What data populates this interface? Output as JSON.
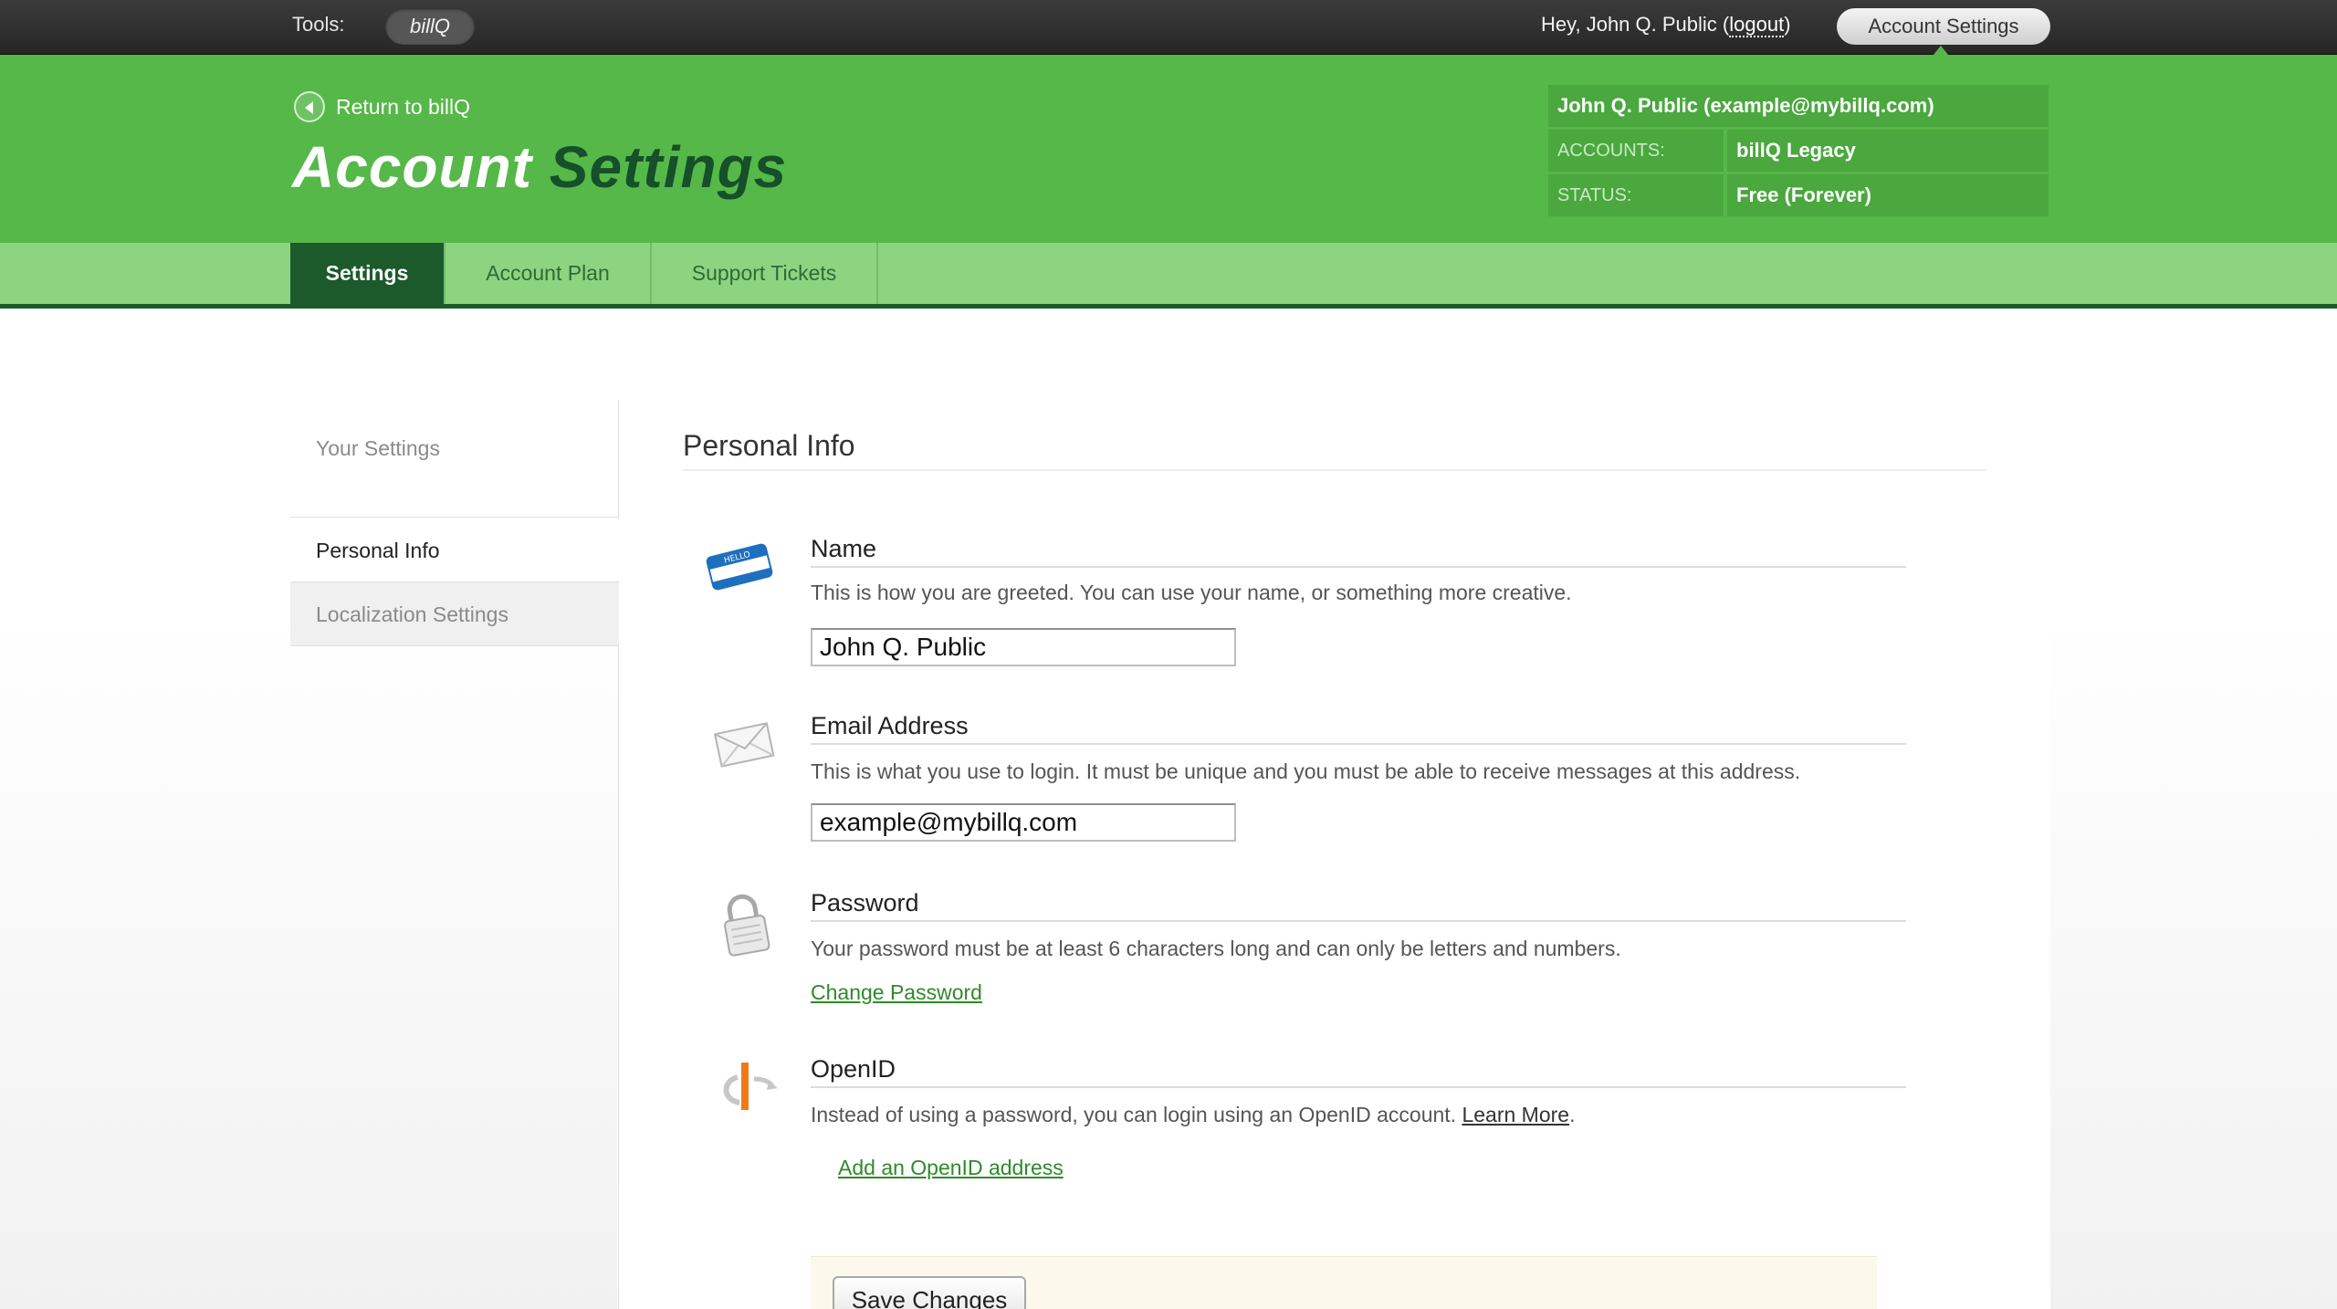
{
  "topbar": {
    "tools_label": "Tools:",
    "tool_name": "billQ",
    "greeting_prefix": "Hey, John Q. Public (",
    "logout_label": "logout",
    "greeting_suffix": ")",
    "account_settings_label": "Account Settings"
  },
  "header": {
    "return_label": "Return to billQ",
    "title_word1": "Account",
    "title_word2": "Settings",
    "user_line": "John Q. Public (example@mybillq.com)",
    "accounts_label": "ACCOUNTS:",
    "accounts_value": "billQ Legacy",
    "status_label": "STATUS:",
    "status_value": "Free (Forever)"
  },
  "tabs": [
    {
      "label": "Settings",
      "active": true
    },
    {
      "label": "Account Plan",
      "active": false
    },
    {
      "label": "Support Tickets",
      "active": false
    }
  ],
  "sidebar": {
    "heading": "Your Settings",
    "items": [
      {
        "label": "Personal Info",
        "selected": true
      },
      {
        "label": "Localization Settings",
        "selected": false
      }
    ]
  },
  "section": {
    "title": "Personal Info"
  },
  "fields": {
    "name": {
      "title": "Name",
      "description": "This is how you are greeted. You can use your name, or something more creative.",
      "value": "John Q. Public",
      "icon": "name-tag-icon"
    },
    "email": {
      "title": "Email Address",
      "description": "This is what you use to login. It must be unique and you must be able to receive messages at this address.",
      "value": "example@mybillq.com",
      "icon": "envelope-icon"
    },
    "password": {
      "title": "Password",
      "description": "Your password must be at least 6 characters long and can only be letters and numbers.",
      "link": "Change Password",
      "icon": "lock-icon"
    },
    "openid": {
      "title": "OpenID",
      "description": "Instead of using a password, you can login using an OpenID account.",
      "learn_more": "Learn More",
      "link": "Add an OpenID address",
      "icon": "openid-icon"
    }
  },
  "actions": {
    "save_label": "Save Changes"
  },
  "colors": {
    "header_green": "#55b848",
    "tab_bar_green": "#8dd481",
    "dark_green": "#1c5a2b",
    "link_green": "#2f8a2a"
  }
}
